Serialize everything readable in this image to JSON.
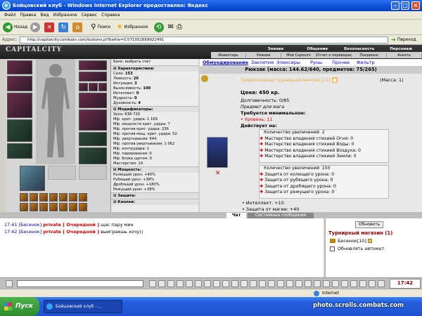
{
  "window": {
    "title": "Бойцовский клуб - Windows Internet Explorer предоставлен: Яндекс"
  },
  "menu": [
    "Файл",
    "Правка",
    "Вид",
    "Избранное",
    "Сервис",
    "Справка"
  ],
  "toolbar": {
    "back": "Назад",
    "search": "Поиск",
    "favorites": "Избранное"
  },
  "address": {
    "label": "Адрес:",
    "url": "http://capitalcity.combats.com/buttons.pl?battle=0.571051669922491",
    "go": "Переход"
  },
  "game": {
    "logo": "CAPITALCITY",
    "nav_top": [
      "Знания",
      "Общение",
      "Безопасность",
      "Персонаж"
    ],
    "nav_sub": [
      "Инвентарь",
      "Умения",
      "Мой Скроолл",
      "Отчет о переводах",
      "Поединки",
      "Анкета"
    ]
  },
  "stats": {
    "bank": "Банк: выбрать счет",
    "characteristics_title": "Характеристики:",
    "characteristics": [
      {
        "k": "Сила:",
        "v": "153"
      },
      {
        "k": "Ловкость:",
        "v": "20"
      },
      {
        "k": "Интуиция:",
        "v": "3"
      },
      {
        "k": "Выносливость:",
        "v": "100"
      },
      {
        "k": "Интеллект:",
        "v": "0"
      },
      {
        "k": "Мудрость:",
        "v": "0"
      },
      {
        "k": "Духовность:",
        "v": "4"
      }
    ],
    "modifiers_title": "Модификаторы:",
    "modifiers": [
      "Урон: 636-720",
      "Мф. крит. удара: 1 169",
      "Мф. мощности крит. удара: 7",
      "Мф. против крит. удара: 236",
      "Мф. против мощ. крит. удара: 52",
      "Мф. увертывания: 644",
      "Мф. против увертывания: 1 062",
      "Мф. контрудара: 1",
      "Мф. парирования: 0",
      "Мф. блока щитом: 0",
      "Мастерство: 24"
    ],
    "power_title": "Мощность:",
    "power": [
      "Колющий урон: +40%",
      "Рубящий урон: +38%",
      "Дробящий урон: +180%",
      "Режущий урон: +38%"
    ],
    "defense_title": "Защита:",
    "buttons_title": "Кнопки:"
  },
  "tabs": [
    "Обмундирование",
    "Заклятия",
    "Эликсиры",
    "Руны",
    "Прочее",
    "Фильтр"
  ],
  "bag": {
    "title": "Рюкзак (масса: 144.62/640, предметов: 75/265)"
  },
  "item": {
    "name": "Превосходная турнирная мантия [11]",
    "mass": "(Масса: 1)",
    "price": "Цена: 450 кр.",
    "durability": "Долговечность: 0/85",
    "magic": "Предмет для мага",
    "req_title": "Требуется минимальное:",
    "req_level": "• Уровень: 11",
    "acts_title": "Действует на:",
    "box1_title": "Количество увеличений: 2",
    "box1": [
      "Мастерство владения стихией Огня: 0",
      "Мастерство владения стихией Воды: 0",
      "Мастерство владения стихией Воздуха: 0",
      "Мастерство владения стихией Земли: 0"
    ],
    "box2_title": "Количество увеличений: 150",
    "box2": [
      "Защита от колющего урона: 0",
      "Защита от рубящего урона: 0",
      "Защита от дробящего урона: 0",
      "Защита от режущего урона: 0"
    ],
    "extra": [
      "• Интеллект: +10",
      "• Защита от магии: +40"
    ]
  },
  "chat": {
    "tab_chat": "Чат",
    "tab_system": "Системные сообщения",
    "lines": [
      {
        "time": "17:41",
        "nick": "[Бесенок]",
        "priv": "private [ Очередной ]",
        "text": "щас пару мин"
      },
      {
        "time": "17:42",
        "nick": "[Бесенок]",
        "priv": "private [ Очередной ]",
        "text": "выиграешь хочу))"
      }
    ]
  },
  "tournament": {
    "update": "Обновить",
    "title": "Турнирный магазин (1)",
    "user": "Бесенок[10]",
    "auto": "Обновлять автомат."
  },
  "clock": "17:42",
  "status": {
    "zone": "Internet"
  },
  "taskbar": {
    "start": "Пуск",
    "task": "Бойцовский клуб - ..."
  },
  "watermark": "photo.scrolls.combats.com"
}
